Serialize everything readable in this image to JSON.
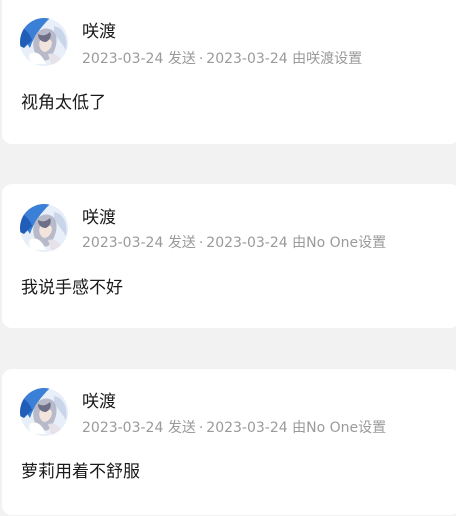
{
  "posts": [
    {
      "author": "咲渡",
      "sent_date": "2023-03-24",
      "sent_label": "发送",
      "dot": "·",
      "set_date": "2023-03-24",
      "set_by_label": "由咲渡设置",
      "comment": "视角太低了"
    },
    {
      "author": "咲渡",
      "sent_date": "2023-03-24",
      "sent_label": "发送",
      "dot": "·",
      "set_date": "2023-03-24",
      "set_by_label": "由No One设置",
      "comment": "我说手感不好"
    },
    {
      "author": "咲渡",
      "sent_date": "2023-03-24",
      "sent_label": "发送",
      "dot": "·",
      "set_date": "2023-03-24",
      "set_by_label": "由No One设置",
      "comment": "萝莉用着不舒服"
    }
  ],
  "colors": {
    "background": "#f2f2f2",
    "card": "#ffffff",
    "text_primary": "#1a1a1a",
    "text_meta": "#9a9a9a"
  },
  "icons": {
    "avatar": "anime-character-avatar"
  }
}
